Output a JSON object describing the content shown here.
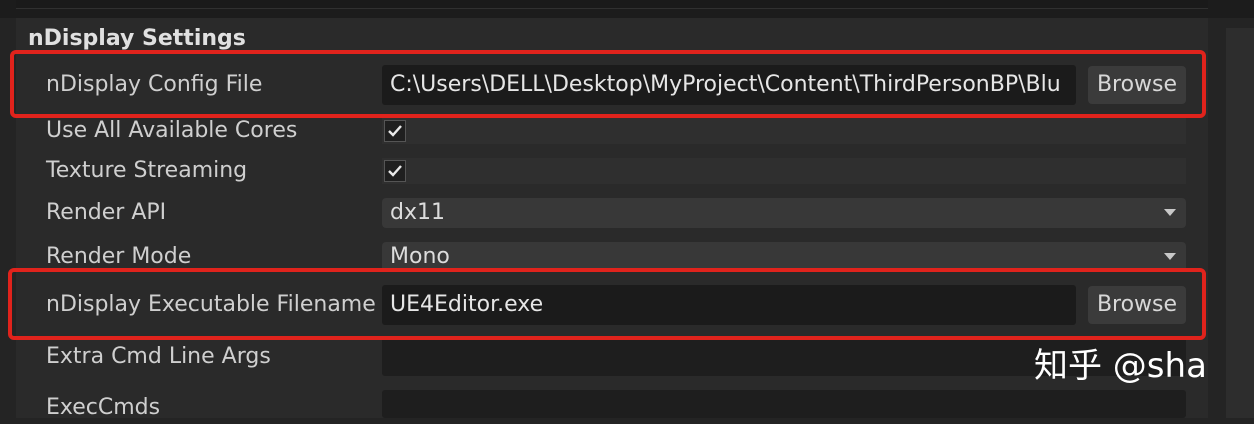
{
  "section": {
    "title": "nDisplay Settings"
  },
  "rows": {
    "config_file": {
      "label": "nDisplay Config File",
      "value": "C:\\Users\\DELL\\Desktop\\MyProject\\Content\\ThirdPersonBP\\Blu",
      "button": "Browse"
    },
    "use_cores": {
      "label": "Use All Available Cores",
      "checked": true
    },
    "texture_streaming": {
      "label": "Texture Streaming",
      "checked": true
    },
    "render_api": {
      "label": "Render API",
      "value": "dx11"
    },
    "render_mode": {
      "label": "Render Mode",
      "value": "Mono"
    },
    "executable": {
      "label": "nDisplay Executable Filename",
      "value": "UE4Editor.exe",
      "button": "Browse"
    },
    "extra_args": {
      "label": "Extra Cmd Line Args",
      "value": ""
    },
    "exec_cmds": {
      "label": "ExecCmds",
      "value": ""
    }
  },
  "watermark": "知乎 @sha",
  "colors": {
    "highlight": "#e0231c",
    "background": "#242424",
    "field": "#1b1b1b"
  }
}
